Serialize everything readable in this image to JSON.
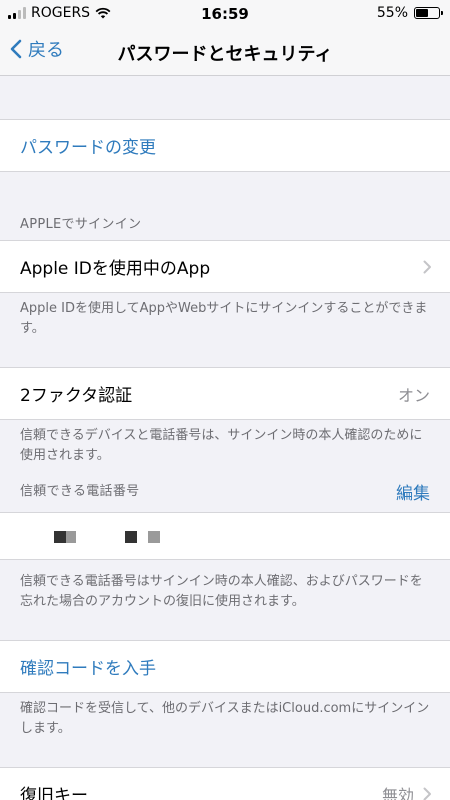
{
  "status_bar": {
    "carrier": "ROGERS",
    "time": "16:59",
    "battery": "55%",
    "battery_level": 0.55
  },
  "nav": {
    "back_label": "戻る",
    "title": "パスワードとセキュリティ"
  },
  "change_password": "パスワードの変更",
  "apple_signin": {
    "header": "APPLEでサインイン",
    "apps_label": "Apple IDを使用中のApp",
    "footer": "Apple IDを使用してAppやWebサイトにサインインすることができます。"
  },
  "two_factor": {
    "label": "2ファクタ認証",
    "value": "オン",
    "footer": "信頼できるデバイスと電話番号は、サインイン時の本人確認のために使用されます。",
    "trusted_header": "信頼できる電話番号",
    "edit_label": "編集",
    "phone_footer": "信頼できる電話番号はサインイン時の本人確認、およびパスワードを忘れた場合のアカウントの復旧に使用されます。"
  },
  "verification": {
    "label": "確認コードを入手",
    "footer": "確認コードを受信して、他のデバイスまたはiCloud.comにサインインします。"
  },
  "recovery_key": {
    "label": "復旧キー",
    "value": "無効"
  },
  "colors": {
    "accent": "#2f7bbd",
    "background": "#f2f2f7",
    "secondary_text": "#6d6d72"
  }
}
